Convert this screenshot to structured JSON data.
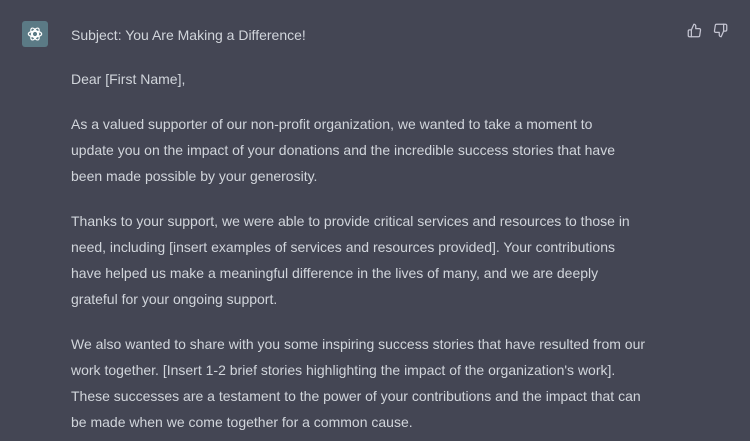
{
  "message": {
    "subject": "Subject: You Are Making a Difference!",
    "greeting": "Dear [First Name],",
    "paragraphs": [
      [
        "As a valued supporter of our non-profit organization, we wanted to take a moment to",
        "update you on the impact of your donations and the incredible success stories that have",
        "been made possible by your generosity."
      ],
      [
        "Thanks to your support, we were able to provide critical services and resources to those in",
        "need, including [insert examples of services and resources provided]. Your contributions",
        "have helped us make a meaningful difference in the lives of many, and we are deeply",
        "grateful for your ongoing support."
      ],
      [
        "We also wanted to share with you some inspiring success stories that have resulted from our",
        "work together. [Insert 1-2 brief stories highlighting the impact of the organization's work].",
        "These successes are a testament to the power of your contributions and the impact that can",
        "be made when we come together for a common cause."
      ]
    ]
  },
  "icons": {
    "avatar": "assistant-logo-icon",
    "thumbs_up": "thumbs-up-icon",
    "thumbs_down": "thumbs-down-icon"
  },
  "colors": {
    "background": "#444654",
    "text": "#d1d5db",
    "avatar_bg": "#5b7a85",
    "icon": "#c5c5d2"
  }
}
